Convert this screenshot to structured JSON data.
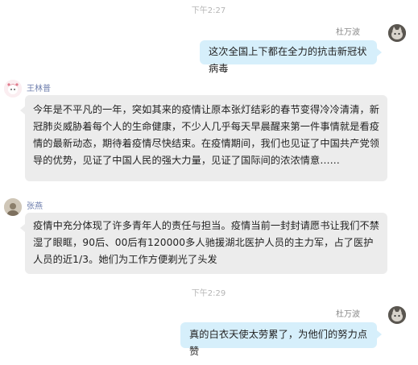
{
  "messages": [
    {
      "kind": "time",
      "text": "下午2:27"
    },
    {
      "kind": "msg",
      "side": "right",
      "name": "杜万波",
      "text": "这次全国上下都在全力的抗击新冠状病毒",
      "avatar": "avatar-cat-photo"
    },
    {
      "kind": "msg",
      "side": "left",
      "name": "王林普",
      "text": "今年是不平凡的一年，突如其来的疫情让原本张灯结彩的春节变得冷冷清清，新冠肺炎威胁着每个人的生命健康，不少人几乎每天早晨醒来第一件事情就是看疫情的最新动态，期待着疫情尽快结束。在疫情期间，我们也见证了中国共产党领导的优势，见证了中国人民的强大力量，见证了国际间的浓浓情意……",
      "avatar": "avatar-cartoon-girl"
    },
    {
      "kind": "msg",
      "side": "left",
      "name": "张燕",
      "text": "疫情中充分体现了许多青年人的责任与担当。疫情当前一封封请愿书让我们不禁湿了眼眶，90后、00后有120000多人驰援湖北医护人员的主力军，占了医护人员的近1/3。她们为工作方便剃光了头发",
      "avatar": "avatar-photo"
    },
    {
      "kind": "time",
      "text": "下午2:29"
    },
    {
      "kind": "msg",
      "side": "right",
      "name": "杜万波",
      "text": "真的白衣天使太劳累了，为他们的努力点赞",
      "avatar": "avatar-cat-photo"
    }
  ],
  "colors": {
    "bubble_left": "#ececec",
    "bubble_right": "#d6effb",
    "name_left": "#6f7fae"
  }
}
